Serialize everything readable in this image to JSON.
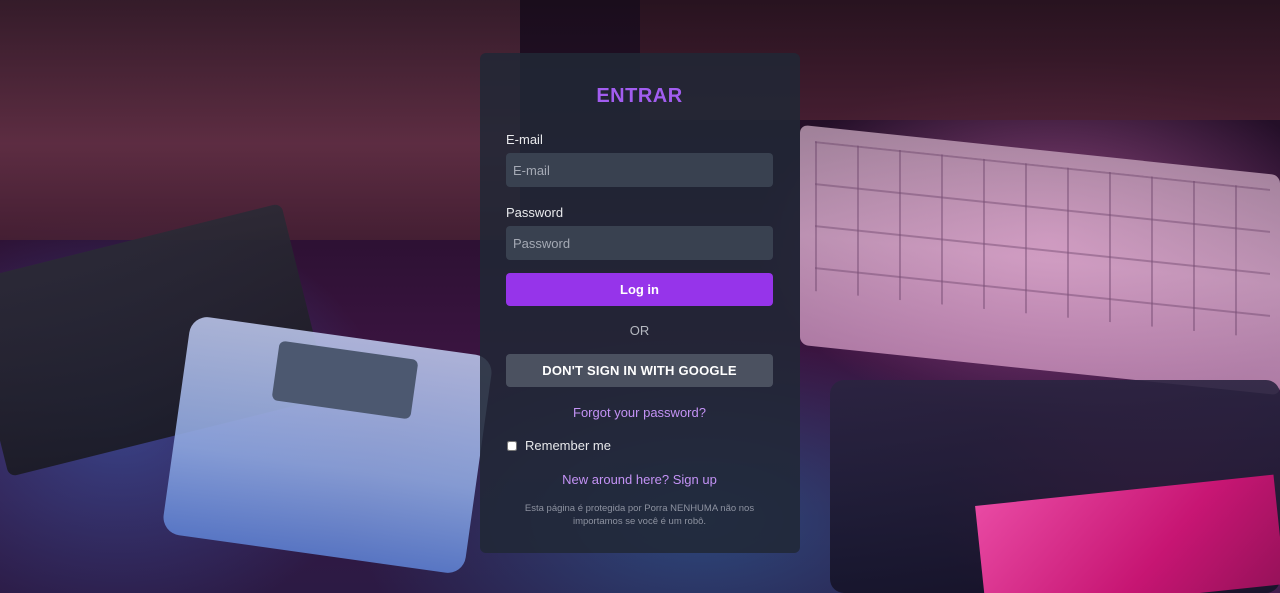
{
  "login": {
    "title": "ENTRAR",
    "email_label": "E-mail",
    "email_placeholder": "E-mail",
    "password_label": "Password",
    "password_placeholder": "Password",
    "login_button": "Log in",
    "divider": "OR",
    "google_button": "DON'T SIGN IN WITH GOOGLE",
    "forgot_link": "Forgot your password?",
    "remember_label": "Remember me",
    "remember_checked": false,
    "signup_link": "New around here? Sign up",
    "footnote": "Esta página é protegida por Porra NENHUMA não nos importamos se você é um robô."
  },
  "colors": {
    "accent": "#9634ea",
    "title": "#a25df0",
    "link": "#c392f5",
    "card_bg": "#212836",
    "field_bg": "#394150",
    "secondary_button": "#4b5160"
  }
}
